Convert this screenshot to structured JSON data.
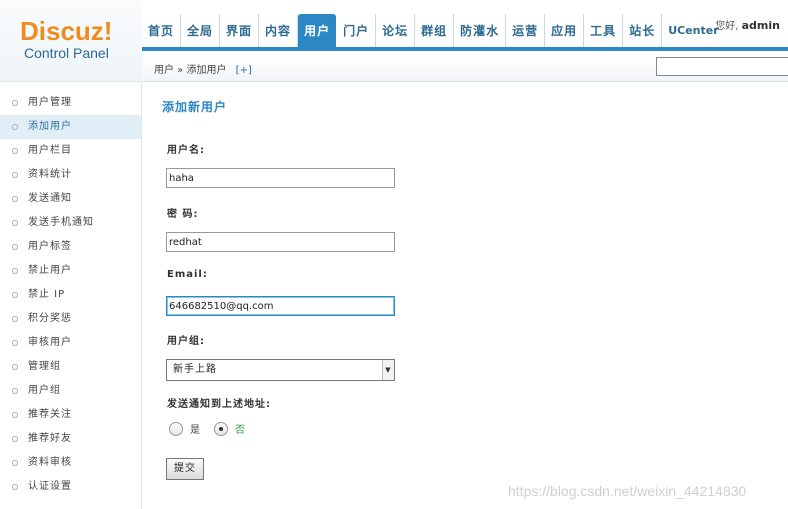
{
  "logo": {
    "main": "Discuz!",
    "sub": "Control Panel"
  },
  "nav": {
    "items": [
      {
        "label": "首页"
      },
      {
        "label": "全局"
      },
      {
        "label": "界面"
      },
      {
        "label": "内容"
      },
      {
        "label": "用户"
      },
      {
        "label": "门户"
      },
      {
        "label": "论坛"
      },
      {
        "label": "群组"
      },
      {
        "label": "防灌水"
      },
      {
        "label": "运营"
      },
      {
        "label": "应用"
      },
      {
        "label": "工具"
      },
      {
        "label": "站长"
      },
      {
        "label": "UCenter"
      }
    ],
    "active": "用户"
  },
  "userinfo": {
    "greeting": "您好,",
    "username": "admin"
  },
  "breadcrumb": {
    "text": "用户 » 添加用户",
    "plus": "[+]"
  },
  "search": {
    "value": ""
  },
  "sidebar": {
    "items": [
      {
        "label": "用户管理"
      },
      {
        "label": "添加用户"
      },
      {
        "label": "用户栏目"
      },
      {
        "label": "资料统计"
      },
      {
        "label": "发送通知"
      },
      {
        "label": "发送手机通知"
      },
      {
        "label": "用户标签"
      },
      {
        "label": "禁止用户"
      },
      {
        "label": "禁止 IP"
      },
      {
        "label": "积分奖惩"
      },
      {
        "label": "审核用户"
      },
      {
        "label": "管理组"
      },
      {
        "label": "用户组"
      },
      {
        "label": "推荐关注"
      },
      {
        "label": "推荐好友"
      },
      {
        "label": "资料审核"
      },
      {
        "label": "认证设置"
      }
    ],
    "active": "添加用户"
  },
  "form": {
    "title": "添加新用户",
    "username_label": "用户名:",
    "username_value": "haha",
    "password_label": "密 码:",
    "password_value": "redhat",
    "email_label": "Email:",
    "email_value": "646682510@qq.com",
    "group_label": "用户组:",
    "group_value": "新手上路",
    "notify_label": "发送通知到上述地址:",
    "notify_yes": "是",
    "notify_no": "否",
    "notify_selected": "否",
    "submit_label": "提交"
  },
  "watermark": "https://blog.csdn.net/weixin_44214830",
  "colors": {
    "accent": "#2c87c4",
    "logo_orange": "#f08c1e",
    "radio_selected": "#2a9a3a"
  }
}
